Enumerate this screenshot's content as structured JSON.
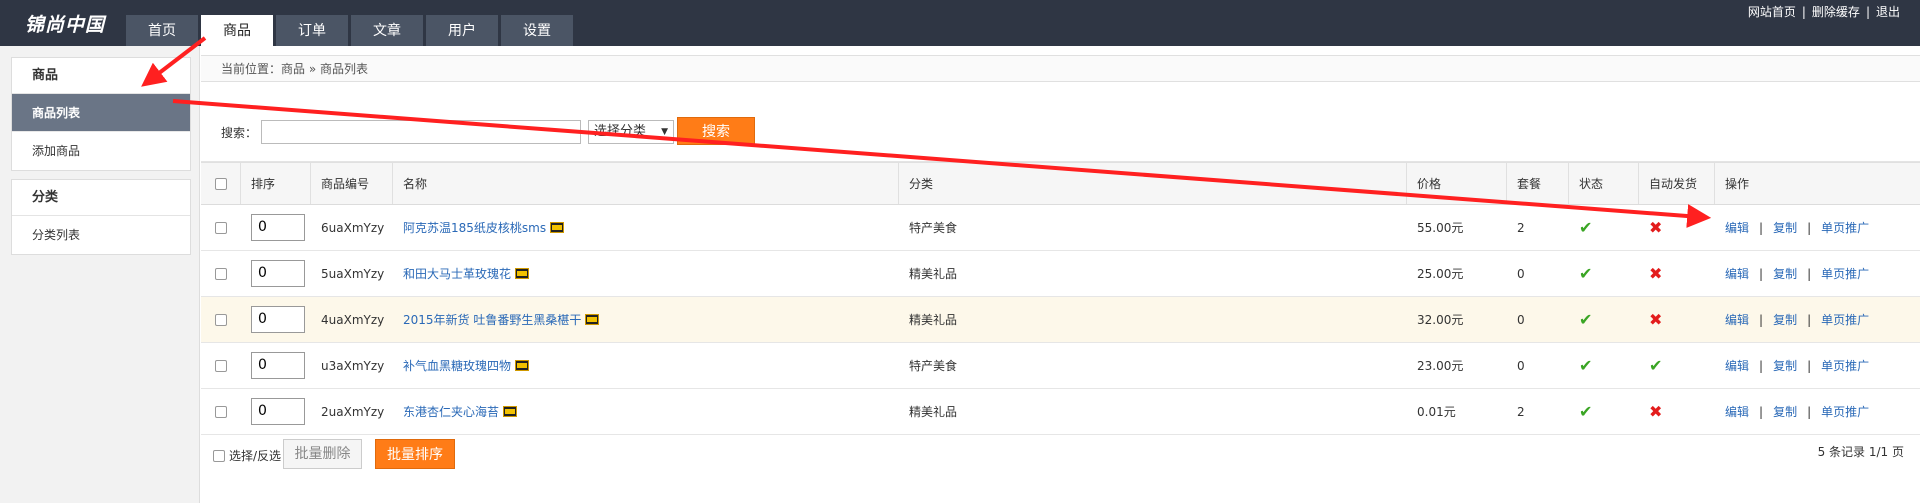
{
  "app": {
    "logo": "锦尚中国",
    "nav_tabs": [
      {
        "label": "首页"
      },
      {
        "label": "商品"
      },
      {
        "label": "订单"
      },
      {
        "label": "文章"
      },
      {
        "label": "用户"
      },
      {
        "label": "设置"
      }
    ],
    "active_tab": "商品",
    "top_links": [
      "网站首页",
      "删除缓存",
      "退出"
    ],
    "top_links_separator": "|"
  },
  "sidebar": {
    "groups": [
      {
        "title": "商品",
        "items": [
          {
            "label": "商品列表",
            "active": true
          },
          {
            "label": "添加商品",
            "active": false
          }
        ]
      },
      {
        "title": "分类",
        "items": [
          {
            "label": "分类列表",
            "active": false
          }
        ]
      }
    ]
  },
  "breadcrumb": {
    "prefix": "当前位置：",
    "items": [
      "商品",
      "商品列表"
    ],
    "separator": "»"
  },
  "search": {
    "label": "搜索：",
    "value": "",
    "category_select": "选择分类",
    "button": "搜索"
  },
  "table": {
    "columns": [
      "排序",
      "商品编号",
      "名称",
      "分类",
      "价格",
      "套餐",
      "状态",
      "自动发货",
      "操作"
    ],
    "rows": [
      {
        "sort": "0",
        "code": "6uaXmYzy",
        "name": "阿克苏温185纸皮核桃sms",
        "category": "特产美食",
        "price": "55.00元",
        "package": "2",
        "status": "check",
        "auto_ship": "cross",
        "highlight": false
      },
      {
        "sort": "0",
        "code": "5uaXmYzy",
        "name": "和田大马士革玫瑰花",
        "category": "精美礼品",
        "price": "25.00元",
        "package": "0",
        "status": "check",
        "auto_ship": "cross",
        "highlight": false
      },
      {
        "sort": "0",
        "code": "4uaXmYzy",
        "name": "2015年新货 吐鲁番野生黑桑椹干",
        "category": "精美礼品",
        "price": "32.00元",
        "package": "0",
        "status": "check",
        "auto_ship": "cross",
        "highlight": true
      },
      {
        "sort": "0",
        "code": "u3aXmYzy",
        "name": "补气血黑糖玫瑰四物",
        "category": "特产美食",
        "price": "23.00元",
        "package": "0",
        "status": "check",
        "auto_ship": "check",
        "highlight": false
      },
      {
        "sort": "0",
        "code": "2uaXmYzy",
        "name": "东港杏仁夹心海苔",
        "category": "精美礼品",
        "price": "0.01元",
        "package": "2",
        "status": "check",
        "auto_ship": "cross",
        "highlight": false
      }
    ],
    "row_actions": [
      "编辑",
      "复制",
      "单页推广"
    ],
    "action_separator": "|"
  },
  "footer": {
    "select_all": "选择/反选",
    "batch_delete": "批量删除",
    "batch_sort": "批量排序",
    "pagination": "5 条记录 1/1 页"
  },
  "colors": {
    "topbar": "#2f3644",
    "accent_orange": "#ff7c17",
    "link_blue": "#2a69b7",
    "check_green": "#3aa524",
    "cross_red": "#e31c1c",
    "annotation_red": "#ff2020"
  },
  "icons": {
    "status_ok": "check-icon",
    "status_no": "cross-icon",
    "product_image": "image-icon"
  }
}
